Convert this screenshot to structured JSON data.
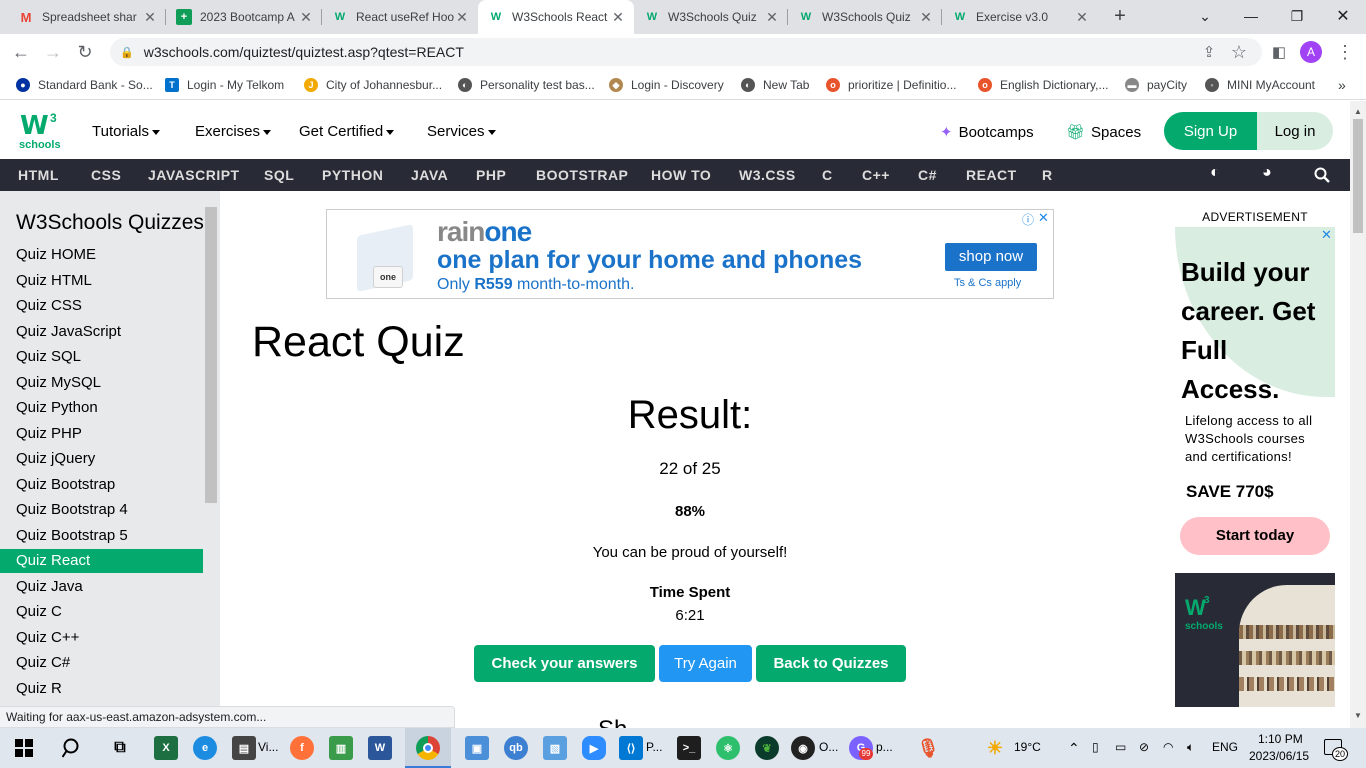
{
  "browser": {
    "tabs": [
      {
        "title": "Spreadsheet shar",
        "icon": "gmail-icon",
        "color": "#ea4335"
      },
      {
        "title": "2023 Bootcamp A",
        "icon": "sheets-icon",
        "color": "#0f9d58"
      },
      {
        "title": "React useRef Hoo",
        "icon": "w3-icon",
        "color": "#04aa6d"
      },
      {
        "title": "W3Schools React",
        "icon": "w3-icon",
        "color": "#04aa6d"
      },
      {
        "title": "W3Schools Quiz",
        "icon": "w3-icon",
        "color": "#04aa6d"
      },
      {
        "title": "W3Schools Quiz",
        "icon": "w3-icon",
        "color": "#04aa6d"
      },
      {
        "title": "Exercise v3.0",
        "icon": "w3-icon",
        "color": "#04aa6d"
      }
    ],
    "url": "w3schools.com/quiztest/quiztest.asp?qtest=REACT",
    "profile_initial": "A",
    "bookmarks": [
      {
        "label": "Standard Bank - So...",
        "color": "#0033a1"
      },
      {
        "label": "Login - My Telkom",
        "color": "#0072ce"
      },
      {
        "label": "City of Johannesbur...",
        "color": "#f2a900"
      },
      {
        "label": "Personality test bas...",
        "color": "#444"
      },
      {
        "label": "Login - Discovery",
        "color": "#b08850"
      },
      {
        "label": "New Tab",
        "color": "#444"
      },
      {
        "label": "prioritize | Definitio...",
        "color": "#e8542c"
      },
      {
        "label": "English Dictionary,...",
        "color": "#e8542c"
      },
      {
        "label": "payCity",
        "color": "#888"
      },
      {
        "label": "MINI MyAccount",
        "color": "#444"
      }
    ],
    "more_bookmarks": "»",
    "status_text": "Waiting for aax-us-east.amazon-adsystem.com..."
  },
  "header": {
    "logo_text": "schools",
    "logo_w": "W",
    "logo_sup": "3",
    "menus": [
      "Tutorials",
      "Exercises",
      "Get Certified",
      "Services"
    ],
    "bootcamps": "Bootcamps",
    "spaces": "Spaces",
    "signup": "Sign Up",
    "login": "Log in"
  },
  "topics": [
    "HTML",
    "CSS",
    "JAVASCRIPT",
    "SQL",
    "PYTHON",
    "JAVA",
    "PHP",
    "BOOTSTRAP",
    "HOW TO",
    "W3.CSS",
    "C",
    "C++",
    "C#",
    "REACT",
    "R"
  ],
  "sidebar": {
    "title": "W3Schools Quizzes",
    "items": [
      "Quiz HOME",
      "Quiz HTML",
      "Quiz CSS",
      "Quiz JavaScript",
      "Quiz SQL",
      "Quiz MySQL",
      "Quiz Python",
      "Quiz PHP",
      "Quiz jQuery",
      "Quiz Bootstrap",
      "Quiz Bootstrap 4",
      "Quiz Bootstrap 5",
      "Quiz React",
      "Quiz Java",
      "Quiz C",
      "Quiz C++",
      "Quiz C#",
      "Quiz R"
    ],
    "active_index": 12
  },
  "ad_banner": {
    "brand_a": "rain",
    "brand_b": "one",
    "headline_a": "one",
    "headline_b": " plan for your home and phones",
    "sub_a": "Only ",
    "sub_b": "R559",
    "sub_c": " month-to-month.",
    "cta": "shop now",
    "terms": "Ts & Cs apply",
    "box_text": "one"
  },
  "quiz": {
    "title": "React Quiz",
    "result_label": "Result:",
    "score": "22 of 25",
    "percent": "88%",
    "message": "You can be proud of yourself!",
    "time_label": "Time Spent",
    "time_value": "6:21",
    "btn_check": "Check your answers",
    "btn_try": "Try Again",
    "btn_back": "Back to Quizzes",
    "partial_text": "Sh"
  },
  "right_ad": {
    "label": "ADVERTISEMENT",
    "headline": "Build your career. Get Full Access.",
    "body": "Lifelong access to all W3Schools courses and certifications!",
    "save": "SAVE 770$",
    "cta": "Start today",
    "logo_w": "W",
    "logo_sup": "3",
    "logo_text": "schools"
  },
  "taskbar": {
    "vlc_label": "Vi...",
    "vscode_label": "P...",
    "obs_label": "O...",
    "chrome2_label": "p...",
    "weather": "19°C",
    "lang": "ENG",
    "time": "1:10 PM",
    "date": "2023/06/15",
    "notif_count": "20",
    "badge_99": "99"
  },
  "colors": {
    "w3_green": "#04aa6d",
    "topics_bg": "#282a35",
    "try_blue": "#2196f3",
    "rain_blue": "#1a73c9"
  }
}
